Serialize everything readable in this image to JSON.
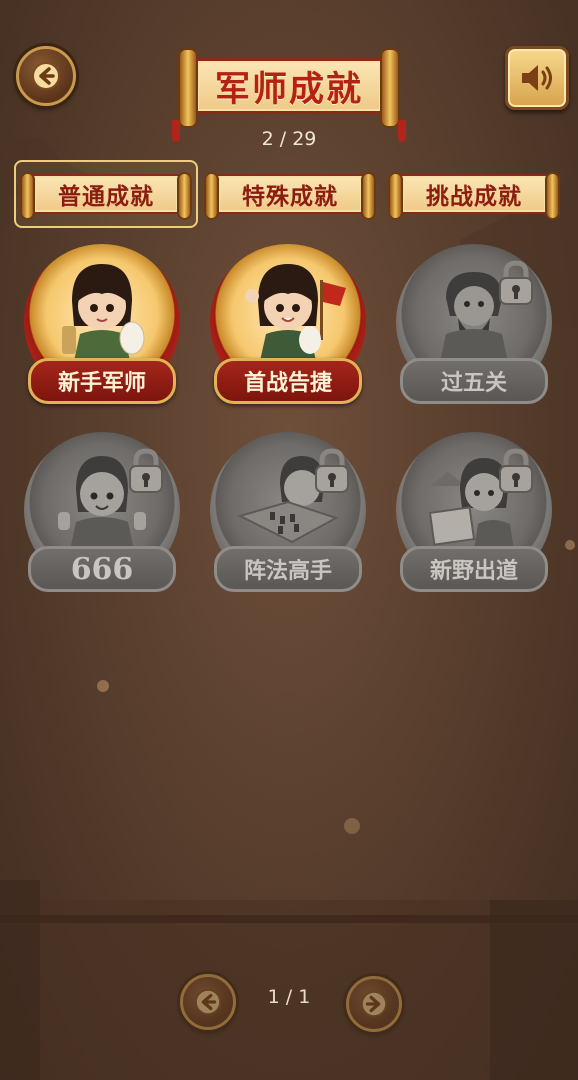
{
  "header": {
    "title": "军师成就",
    "progress": "2 / 29"
  },
  "tabs": [
    {
      "label": "普通成就",
      "active": true
    },
    {
      "label": "特殊成就",
      "active": false
    },
    {
      "label": "挑战成就",
      "active": false
    }
  ],
  "badges": [
    {
      "label": "新手军师",
      "locked": false
    },
    {
      "label": "首战告捷",
      "locked": false
    },
    {
      "label": "过五关",
      "locked": true
    },
    {
      "label": "666",
      "locked": true
    },
    {
      "label": "阵法高手",
      "locked": true
    },
    {
      "label": "新野出道",
      "locked": true
    }
  ],
  "pagination": {
    "page_text": "1 / 1"
  },
  "colors": {
    "accent_red": "#b42213",
    "gold": "#e3b255",
    "background": "#5a3f2e"
  }
}
